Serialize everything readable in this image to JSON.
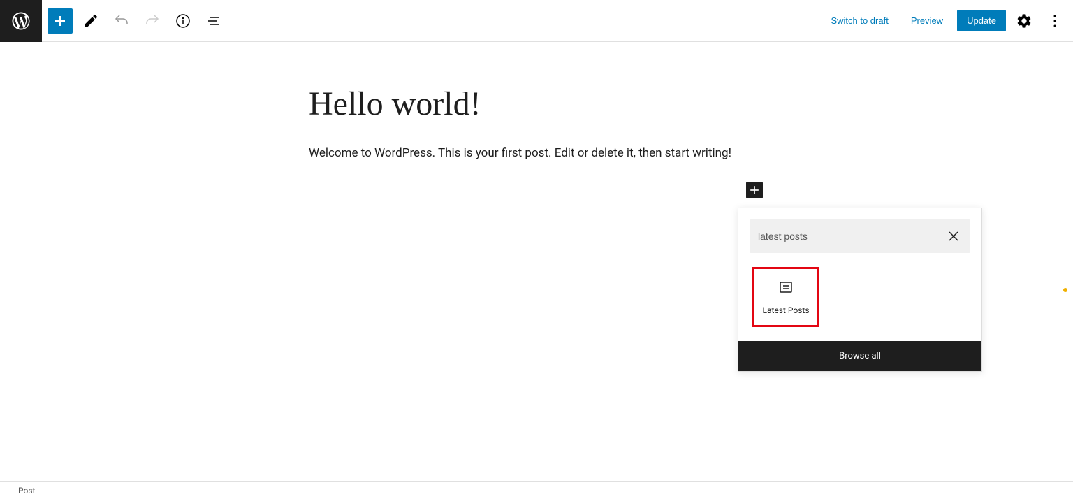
{
  "header": {
    "switch_to_draft": "Switch to draft",
    "preview": "Preview",
    "update": "Update"
  },
  "post": {
    "title": "Hello world!",
    "body": "Welcome to WordPress. This is your first post. Edit or delete it, then start writing!"
  },
  "inserter": {
    "search_value": "latest posts",
    "result_label": "Latest Posts",
    "browse_all": "Browse all"
  },
  "footer": {
    "breadcrumb": "Post"
  }
}
